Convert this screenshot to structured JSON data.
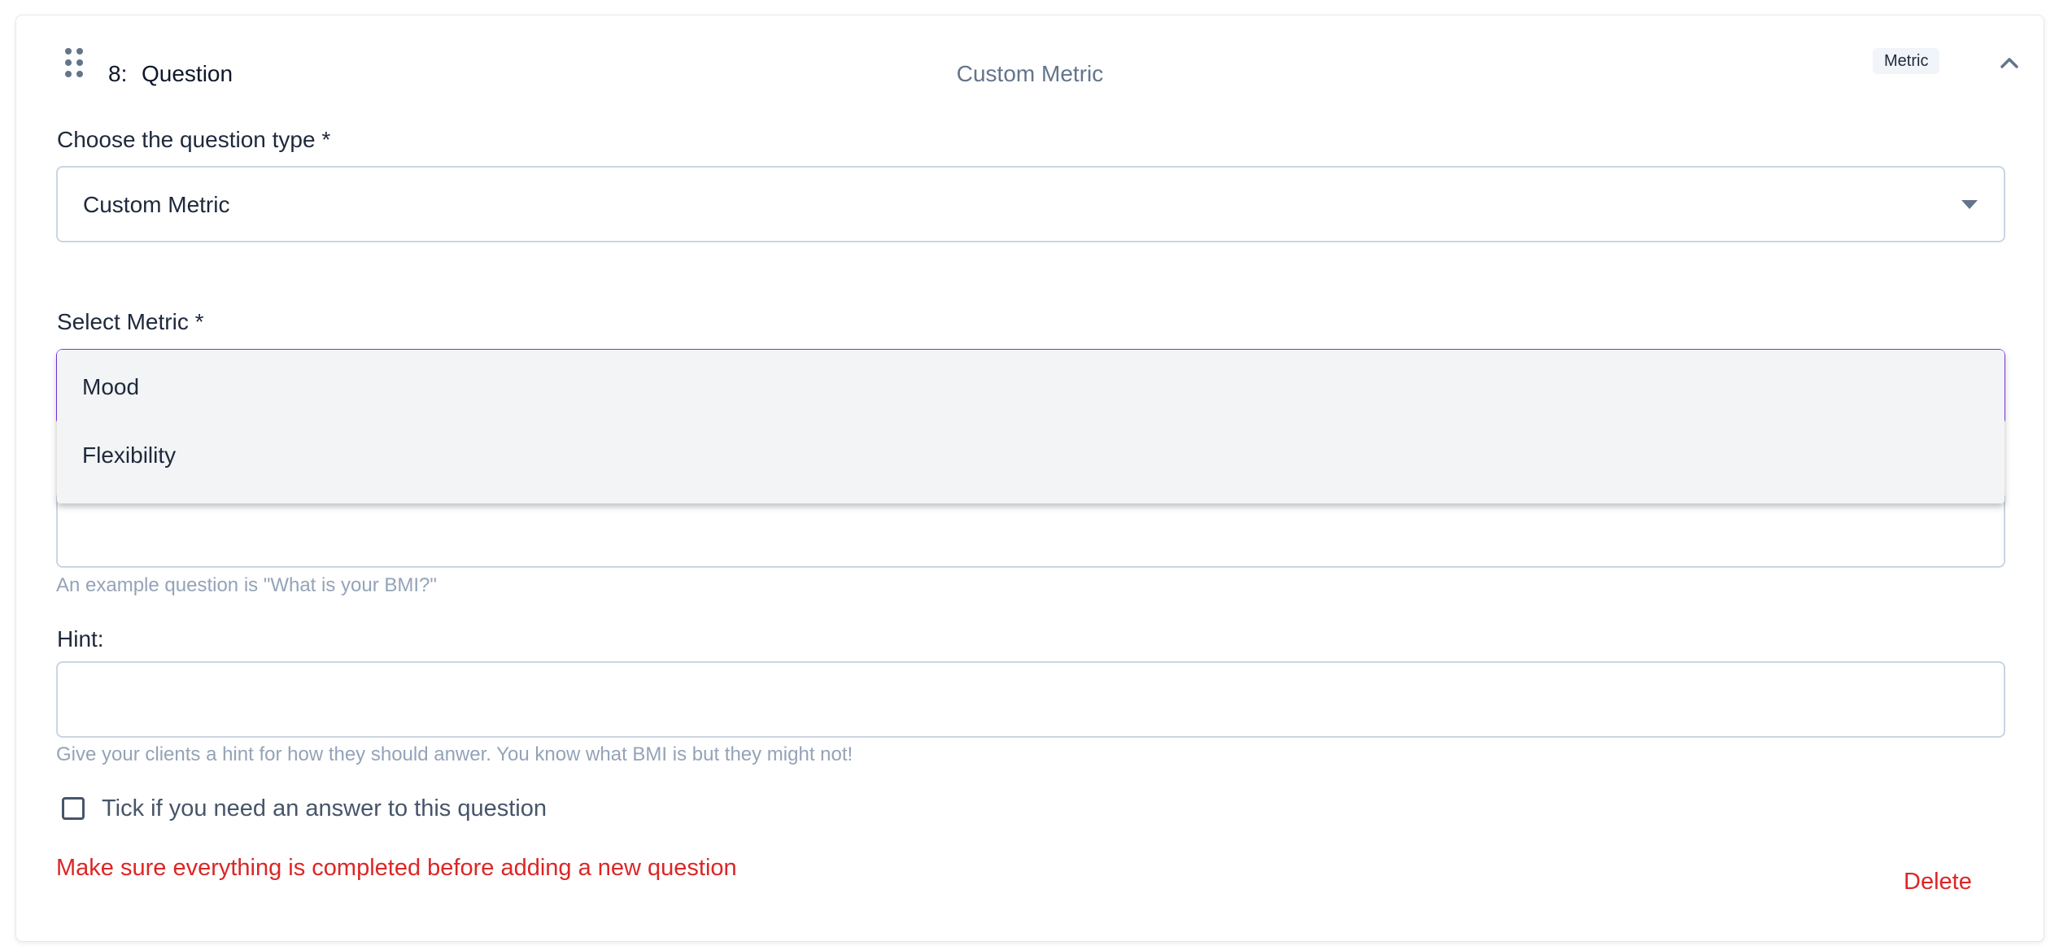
{
  "question": {
    "number": "8:",
    "title": "Question",
    "type_display": "Custom Metric",
    "badge": "Metric"
  },
  "question_type": {
    "label": "Choose the question type *",
    "selected": "Custom Metric"
  },
  "metric": {
    "label": "Select Metric *",
    "options": [
      "Mood",
      "Flexibility"
    ]
  },
  "question_text": {
    "value": "",
    "helper": "An example question is \"What is your BMI?\""
  },
  "hint": {
    "label": "Hint:",
    "value": "",
    "helper": "Give your clients a hint for how they should anwer. You know what BMI is but they might not!"
  },
  "required": {
    "label": "Tick if you need an answer to this question",
    "checked": false
  },
  "validation_message": "Make sure everything is completed before adding a new question",
  "actions": {
    "delete_label": "Delete"
  },
  "colors": {
    "accent_focus": "#7c3aed",
    "error": "#dc2626",
    "muted_text": "#94a3b8"
  },
  "icons": {
    "drag": "drag-handle-icon",
    "collapse": "chevron-up-icon",
    "dropdown": "caret-down-icon"
  }
}
